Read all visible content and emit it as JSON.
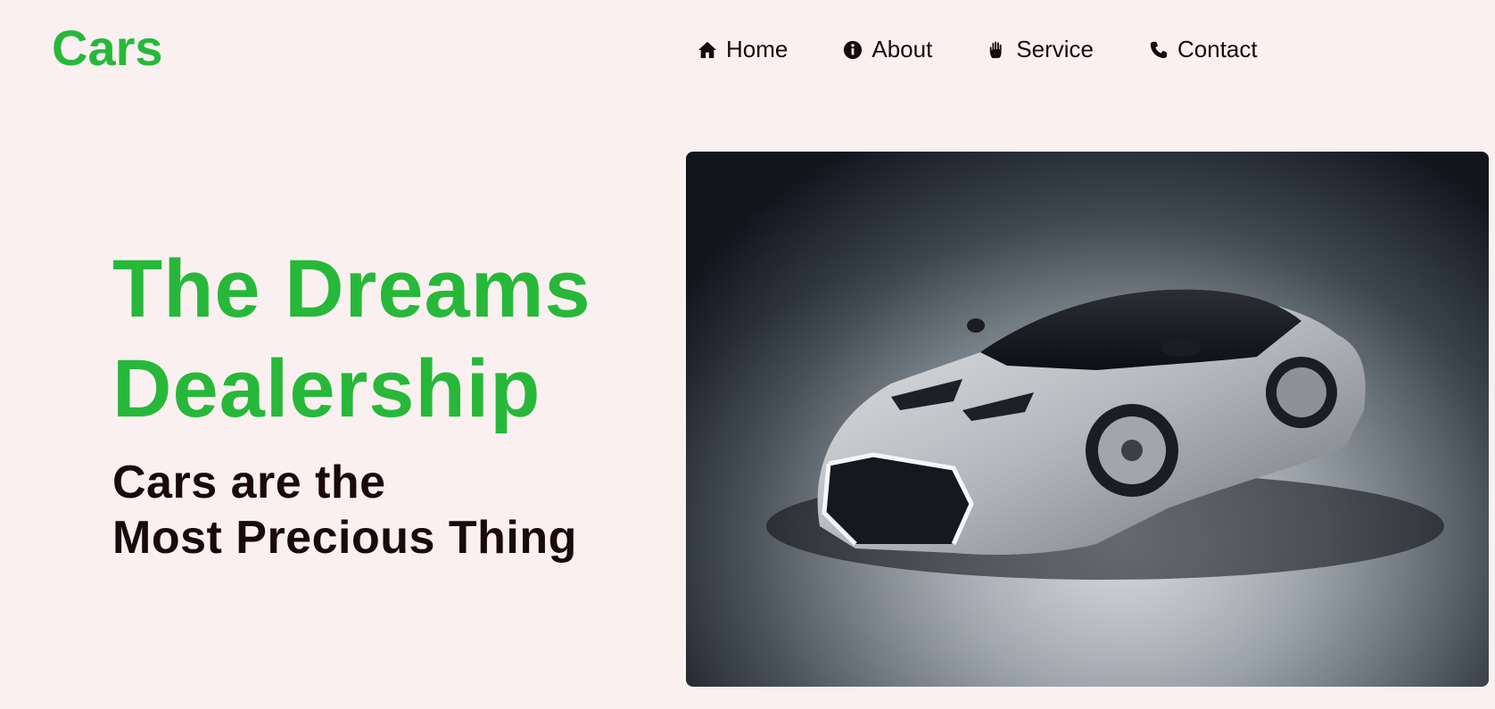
{
  "header": {
    "logo": "Cars",
    "nav": [
      {
        "label": "Home",
        "icon": "home-icon"
      },
      {
        "label": "About",
        "icon": "info-icon"
      },
      {
        "label": "Service",
        "icon": "hand-icon"
      },
      {
        "label": "Contact",
        "icon": "phone-icon"
      }
    ]
  },
  "hero": {
    "title_line1": "The Dreams",
    "title_line2": "Dealership",
    "subtitle_line1": "Cars are the",
    "subtitle_line2": "Most Precious Thing"
  },
  "colors": {
    "accent": "#27b83a",
    "background": "#fbf0f0",
    "text": "#1a0a0a"
  }
}
